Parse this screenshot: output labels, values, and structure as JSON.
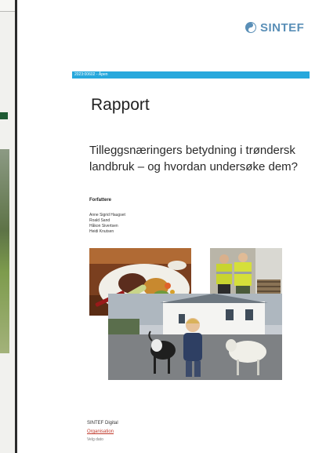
{
  "report": {
    "logo_text": "SINTEF",
    "id_bar": "2023:00602 - Åpen",
    "type": "Rapport",
    "title": "Tilleggsnæringers betydning i trøndersk landbruk – og hvordan undersøke dem?",
    "authors_heading": "Forfattere",
    "authors": [
      "Anne Sigrid Haugset",
      "Roald Sand",
      "Håkon Sivertsen",
      "Heidi Knutsen"
    ],
    "footer": {
      "org": "SINTEF Digital",
      "unit": "Organisation",
      "date": "Velg dato"
    }
  },
  "photos": [
    {
      "name": "food-plate-photo",
      "subject": "grilled meat and vegetables on a plate"
    },
    {
      "name": "workers-photo",
      "subject": "two men in high-visibility workwear"
    },
    {
      "name": "goats-boy-photo",
      "subject": "boy with goats in front of white buildings"
    }
  ],
  "colors": {
    "accent": "#27a8dc",
    "logo": "#5a8fb7",
    "unit_text": "#c0392b"
  }
}
